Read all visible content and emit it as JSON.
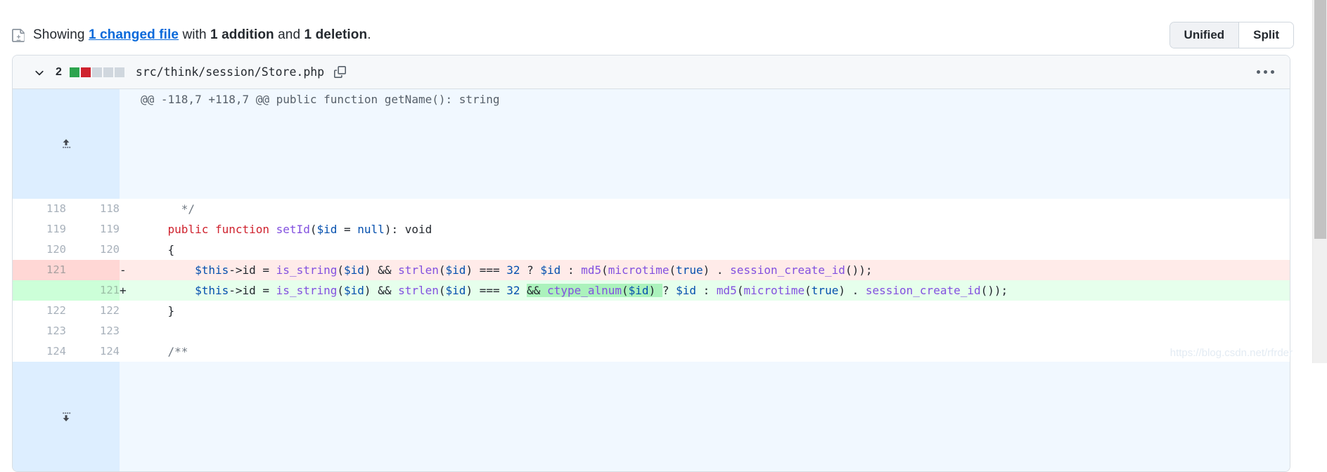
{
  "summary": {
    "icon": "file-diff-icon",
    "prefix": "Showing ",
    "changed_files_link": "1 changed file",
    "with_word": " with ",
    "additions": "1 addition",
    "and_word": " and ",
    "deletions": "1 deletion",
    "period": "."
  },
  "view_toggle": {
    "unified_label": "Unified",
    "split_label": "Split",
    "selected": "Unified"
  },
  "file": {
    "changes_count": "2",
    "path": "src/think/session/Store.php",
    "diffstat": {
      "added_blocks": 1,
      "deleted_blocks": 1,
      "neutral_blocks": 3,
      "added_color": "#2da44e",
      "deleted_color": "#cf222e",
      "neutral_color": "#d0d7de"
    },
    "collapse_icon": "chevron-down-icon",
    "copy_icon": "copy-path-icon",
    "menu_icon": "kebab-menu-icon"
  },
  "hunk": {
    "header": "@@ -118,7 +118,7 @@ public function getName(): string",
    "expand_up_icon": "expand-up-icon",
    "expand_down_icon": "expand-down-icon"
  },
  "lines": [
    {
      "type": "ctx",
      "old_no": "118",
      "new_no": "118",
      "marker": "",
      "tokens": [
        {
          "t": "      ",
          "c": "pl"
        },
        {
          "t": "*/",
          "c": "cm"
        }
      ]
    },
    {
      "type": "ctx",
      "old_no": "119",
      "new_no": "119",
      "marker": "",
      "tokens": [
        {
          "t": "    ",
          "c": "pl"
        },
        {
          "t": "public function ",
          "c": "k"
        },
        {
          "t": "setId",
          "c": "fn"
        },
        {
          "t": "(",
          "c": "pl"
        },
        {
          "t": "$id",
          "c": "v"
        },
        {
          "t": " = ",
          "c": "pl"
        },
        {
          "t": "null",
          "c": "v"
        },
        {
          "t": "): void",
          "c": "pl"
        }
      ]
    },
    {
      "type": "ctx",
      "old_no": "120",
      "new_no": "120",
      "marker": "",
      "tokens": [
        {
          "t": "    {",
          "c": "pl"
        }
      ]
    },
    {
      "type": "del",
      "old_no": "121",
      "new_no": "",
      "marker": "-",
      "tokens": [
        {
          "t": "        ",
          "c": "pl"
        },
        {
          "t": "$this",
          "c": "v"
        },
        {
          "t": "->id = ",
          "c": "pl"
        },
        {
          "t": "is_string",
          "c": "fn"
        },
        {
          "t": "(",
          "c": "pl"
        },
        {
          "t": "$id",
          "c": "v"
        },
        {
          "t": ") && ",
          "c": "pl"
        },
        {
          "t": "strlen",
          "c": "fn"
        },
        {
          "t": "(",
          "c": "pl"
        },
        {
          "t": "$id",
          "c": "v"
        },
        {
          "t": ") === ",
          "c": "pl"
        },
        {
          "t": "32",
          "c": "v"
        },
        {
          "t": " ? ",
          "c": "pl"
        },
        {
          "t": "$id",
          "c": "v"
        },
        {
          "t": " : ",
          "c": "pl"
        },
        {
          "t": "md5",
          "c": "fn"
        },
        {
          "t": "(",
          "c": "pl"
        },
        {
          "t": "microtime",
          "c": "fn"
        },
        {
          "t": "(",
          "c": "pl"
        },
        {
          "t": "true",
          "c": "v"
        },
        {
          "t": ") . ",
          "c": "pl"
        },
        {
          "t": "session_create_id",
          "c": "fn"
        },
        {
          "t": "());",
          "c": "pl"
        }
      ]
    },
    {
      "type": "add",
      "old_no": "",
      "new_no": "121",
      "marker": "+",
      "tokens": [
        {
          "t": "        ",
          "c": "pl"
        },
        {
          "t": "$this",
          "c": "v"
        },
        {
          "t": "->id = ",
          "c": "pl"
        },
        {
          "t": "is_string",
          "c": "fn"
        },
        {
          "t": "(",
          "c": "pl"
        },
        {
          "t": "$id",
          "c": "v"
        },
        {
          "t": ") && ",
          "c": "pl"
        },
        {
          "t": "strlen",
          "c": "fn"
        },
        {
          "t": "(",
          "c": "pl"
        },
        {
          "t": "$id",
          "c": "v"
        },
        {
          "t": ") === ",
          "c": "pl"
        },
        {
          "t": "32",
          "c": "v"
        },
        {
          "t": " ",
          "c": "pl"
        },
        {
          "t": "&& ",
          "c": "pl",
          "hl": true
        },
        {
          "t": "ctype_alnum",
          "c": "fn",
          "hl": true
        },
        {
          "t": "(",
          "c": "pl",
          "hl": true
        },
        {
          "t": "$id",
          "c": "v",
          "hl": true
        },
        {
          "t": ") ",
          "c": "pl",
          "hl": true
        },
        {
          "t": "? ",
          "c": "pl"
        },
        {
          "t": "$id",
          "c": "v"
        },
        {
          "t": " : ",
          "c": "pl"
        },
        {
          "t": "md5",
          "c": "fn"
        },
        {
          "t": "(",
          "c": "pl"
        },
        {
          "t": "microtime",
          "c": "fn"
        },
        {
          "t": "(",
          "c": "pl"
        },
        {
          "t": "true",
          "c": "v"
        },
        {
          "t": ") . ",
          "c": "pl"
        },
        {
          "t": "session_create_id",
          "c": "fn"
        },
        {
          "t": "());",
          "c": "pl"
        }
      ]
    },
    {
      "type": "ctx",
      "old_no": "122",
      "new_no": "122",
      "marker": "",
      "tokens": [
        {
          "t": "    }",
          "c": "pl"
        }
      ]
    },
    {
      "type": "ctx",
      "old_no": "123",
      "new_no": "123",
      "marker": "",
      "tokens": [
        {
          "t": "",
          "c": "pl"
        }
      ]
    },
    {
      "type": "ctx",
      "old_no": "124",
      "new_no": "124",
      "marker": "",
      "tokens": [
        {
          "t": "    ",
          "c": "pl"
        },
        {
          "t": "/**",
          "c": "cm"
        }
      ]
    }
  ],
  "watermark": "https://blog.csdn.net/rfrder"
}
